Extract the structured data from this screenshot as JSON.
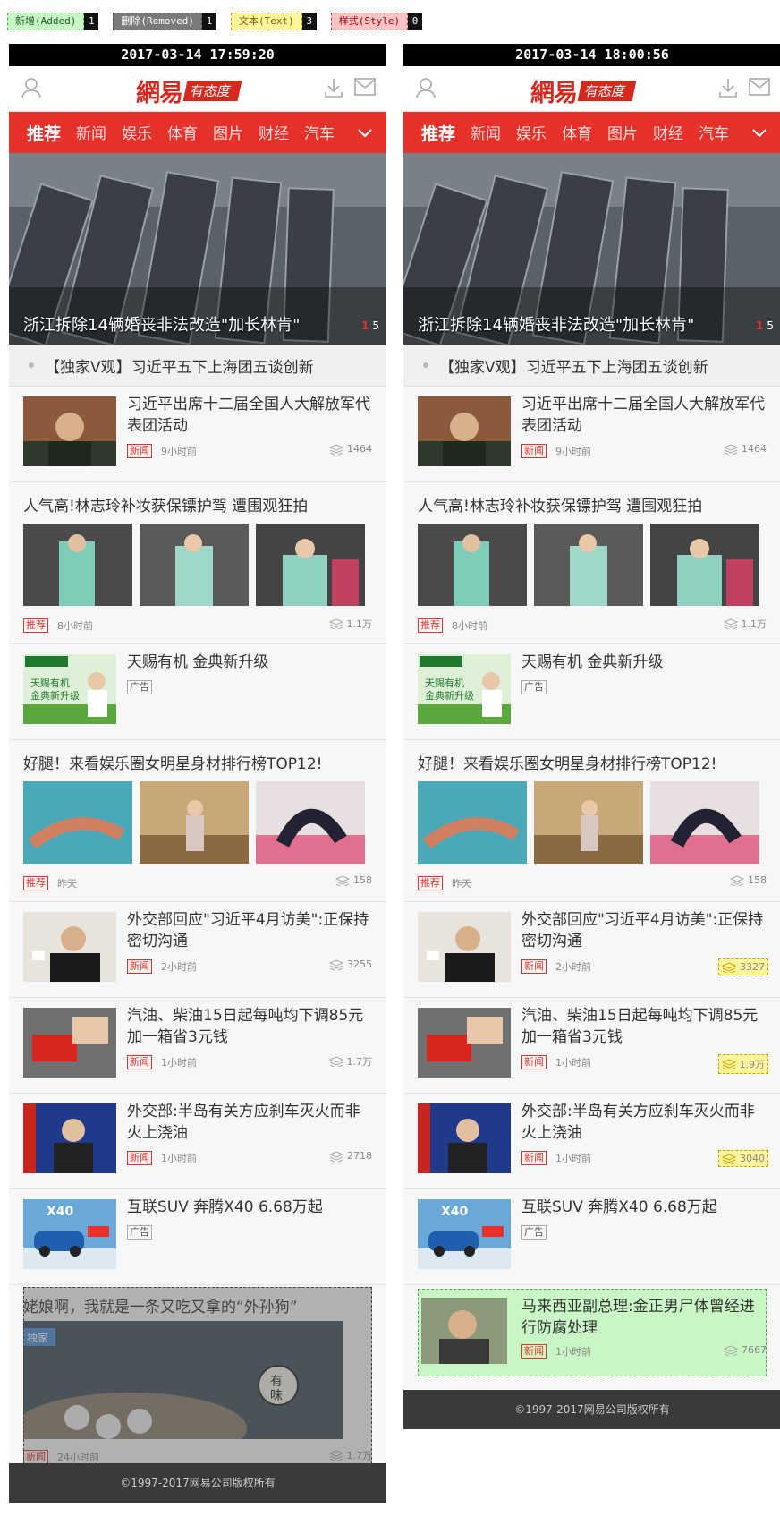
{
  "legend": [
    {
      "label": "新增(Added)",
      "count": "1"
    },
    {
      "label": "删除(Removed)",
      "count": "1"
    },
    {
      "label": "文本(Text)",
      "count": "3"
    },
    {
      "label": "样式(Style)",
      "count": "0"
    }
  ],
  "colors": {
    "brand_red": "#e6302a",
    "added": "#c8f7c5",
    "removed": "#7a7a7a",
    "text_change": "#fff59d",
    "style_change": "#f8c6c6"
  },
  "app": {
    "logo_text": "網易",
    "logo_tag": "有态度",
    "footer": "©1997-2017网易公司版权所有"
  },
  "nav_tabs": [
    "推荐",
    "新闻",
    "娱乐",
    "体育",
    "图片",
    "财经",
    "汽车"
  ],
  "hero": {
    "title": "浙江拆除14辆婚丧非法改造\"加长林肯\"",
    "page_current": "1",
    "page_total": "5"
  },
  "strip_text": "【独家V观】习近平五下上海团五谈创新",
  "left": {
    "timestamp": "2017-03-14 17:59:20",
    "items": {
      "a1": {
        "title": "习近平出席十二届全国人大解放军代表团活动",
        "badge": "新闻",
        "time": "9小时前",
        "comments": "1464"
      },
      "m1": {
        "title": "人气高!林志玲补妆获保镖护驾 遭围观狂拍",
        "badge": "推荐",
        "time": "8小时前",
        "comments": "1.1万"
      },
      "ad1": {
        "title": "天赐有机 金典新升级",
        "badge": "广告"
      },
      "m2": {
        "title": "好腿！来看娱乐圈女明星身材排行榜TOP12!",
        "badge": "推荐",
        "time": "昨天",
        "comments": "158"
      },
      "a2": {
        "title": "外交部回应\"习近平4月访美\":正保持密切沟通",
        "badge": "新闻",
        "time": "2小时前",
        "comments": "3255"
      },
      "a3": {
        "title": "汽油、柴油15日起每吨均下调85元 加一箱省3元钱",
        "badge": "新闻",
        "time": "1小时前",
        "comments": "1.7万"
      },
      "a4": {
        "title": "外交部:半岛有关方应刹车灭火而非火上浇油",
        "badge": "新闻",
        "time": "1小时前",
        "comments": "2718"
      },
      "ad2": {
        "title": "互联SUV 奔腾X40 6.68万起",
        "badge": "广告"
      },
      "big": {
        "title": "姥娘啊，我就是一条又吃又拿的“外孙狗”",
        "img_badge": "独家",
        "stamp": "有味",
        "badge": "新闻",
        "time": "24小时前",
        "comments": "1.7万"
      }
    }
  },
  "right": {
    "timestamp": "2017-03-14 18:00:56",
    "items": {
      "a1": {
        "title": "习近平出席十二届全国人大解放军代表团活动",
        "badge": "新闻",
        "time": "9小时前",
        "comments": "1464"
      },
      "m1": {
        "title": "人气高!林志玲补妆获保镖护驾 遭围观狂拍",
        "badge": "推荐",
        "time": "8小时前",
        "comments": "1.1万"
      },
      "ad1": {
        "title": "天赐有机 金典新升级",
        "badge": "广告"
      },
      "m2": {
        "title": "好腿！来看娱乐圈女明星身材排行榜TOP12!",
        "badge": "推荐",
        "time": "昨天",
        "comments": "158"
      },
      "a2": {
        "title": "外交部回应\"习近平4月访美\":正保持密切沟通",
        "badge": "新闻",
        "time": "2小时前",
        "comments": "3327"
      },
      "a3": {
        "title": "汽油、柴油15日起每吨均下调85元 加一箱省3元钱",
        "badge": "新闻",
        "time": "1小时前",
        "comments": "1.9万"
      },
      "a4": {
        "title": "外交部:半岛有关方应刹车灭火而非火上浇油",
        "badge": "新闻",
        "time": "1小时前",
        "comments": "3040"
      },
      "ad2": {
        "title": "互联SUV 奔腾X40 6.68万起",
        "badge": "广告"
      },
      "added": {
        "title": "马来西亚副总理:金正男尸体曾经进行防腐处理",
        "badge": "新闻",
        "time": "1小时前",
        "comments": "7667"
      }
    }
  }
}
